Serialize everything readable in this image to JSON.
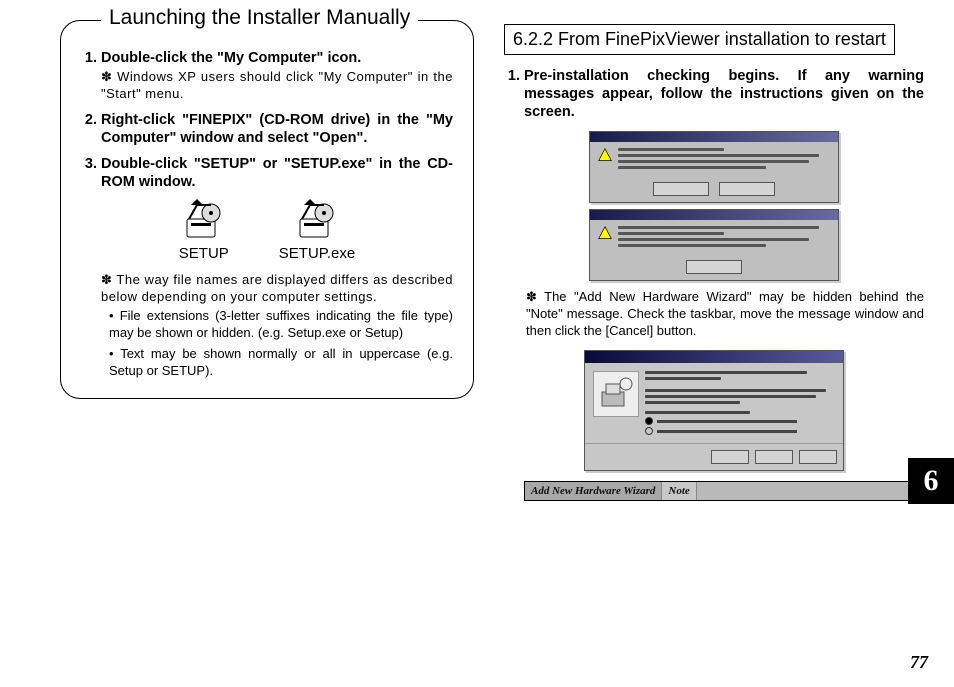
{
  "left": {
    "box_title": "Launching the Installer Manually",
    "steps": {
      "s1": "Double-click the \"My Computer\" icon.",
      "s1_note": "Windows XP users should click \"My Computer\" in the \"Start\" menu.",
      "s2": "Right-click \"FINEPIX\" (CD-ROM drive) in the \"My Computer\" window and select \"Open\".",
      "s3": "Double-click \"SETUP\" or \"SETUP.exe\" in the CD-ROM window."
    },
    "icons": {
      "a": "SETUP",
      "b": "SETUP.exe"
    },
    "note2": "The way file names are displayed differs as described below depending on your computer settings.",
    "bullets": {
      "b1": "File extensions (3-letter suffixes indicating the file type) may be shown or hidden. (e.g. Setup.exe or Setup)",
      "b2": "Text may be shown normally or all in uppercase (e.g. Setup or SETUP)."
    }
  },
  "right": {
    "section": "6.2.2 From FinePixViewer installation to restart",
    "step1": "Pre-installation checking begins. If any warning messages appear, follow the instructions given on the screen.",
    "note": "The \"Add New Hardware Wizard\" may be hidden behind the \"Note\" message. Check the taskbar, move the message window and then click the [Cancel] button.",
    "taskbar": {
      "a": "Add New Hardware Wizard",
      "b": "Note"
    }
  },
  "chapter": "6",
  "page": "77"
}
